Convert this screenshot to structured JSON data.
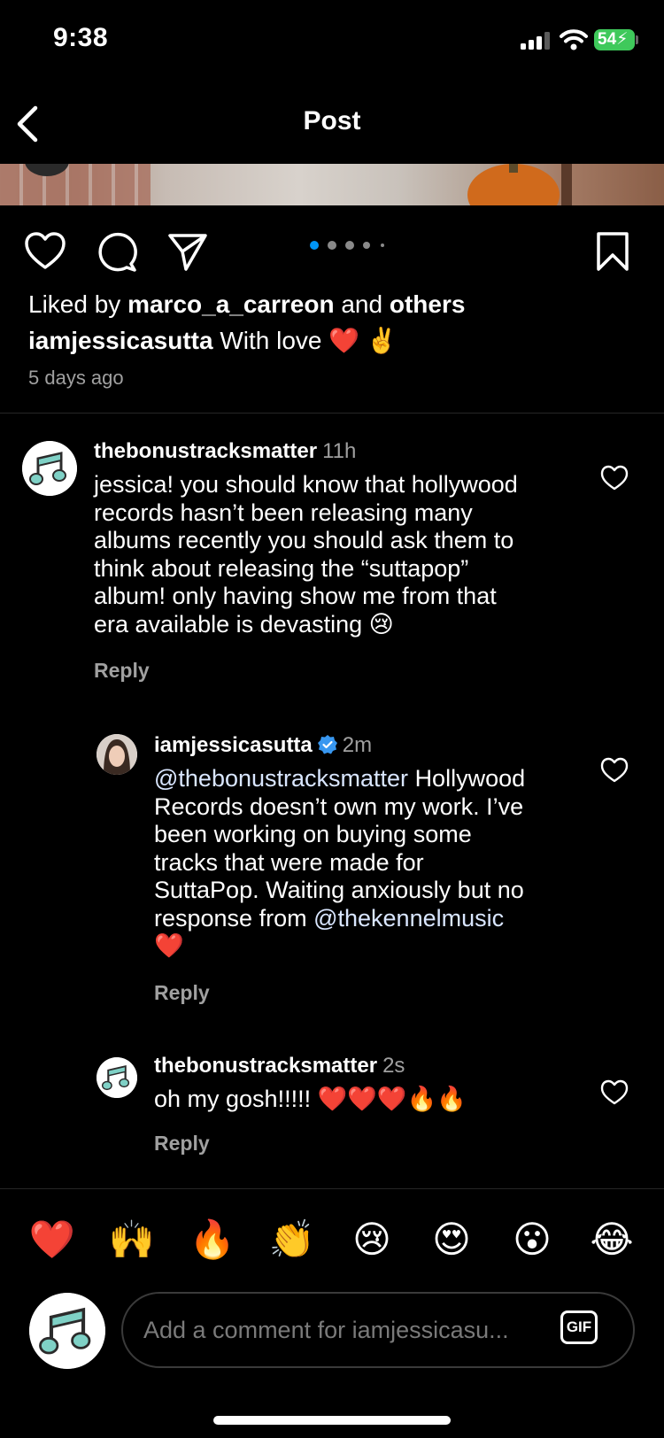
{
  "status_bar": {
    "time": "9:38",
    "battery": "54"
  },
  "nav": {
    "title": "Post"
  },
  "carousel": {
    "dot_count": 5,
    "active_index": 0
  },
  "post": {
    "liked_prefix": "Liked by",
    "liked_user": "marco_a_carreon",
    "liked_mid": "and",
    "liked_others": "others",
    "author": "iamjessicasutta",
    "caption": "With love ❤️ ✌️",
    "time_ago": "5 days ago"
  },
  "comments": [
    {
      "user": "thebonustracksmatter",
      "time": "11h",
      "text_lines": [
        "jessica! you should know that hollywood",
        "records hasn’t been releasing many",
        "albums recently you should ask them to",
        "think about releasing the “suttapop”",
        "album! only having show me from that",
        "era available is devasting 😢"
      ],
      "reply_label": "Reply"
    },
    {
      "user": "iamjessicasutta",
      "time": "2m",
      "verified": true,
      "mention": "@thebonustracksmatter",
      "text_lines": [
        "Hollywood",
        "Records doesn’t own my work. I’ve",
        "been working  on buying some",
        "tracks that were made for",
        "SuttaPop. Waiting anxiously but no",
        "response from"
      ],
      "mention2": "@thekennelmusic",
      "tail": "❤️",
      "reply_label": "Reply"
    },
    {
      "user": "thebonustracksmatter",
      "time": "2s",
      "text": "oh my gosh!!!!! ❤️❤️❤️🔥🔥",
      "reply_label": "Reply"
    }
  ],
  "emoji_bar": [
    "❤️",
    "🙌",
    "🔥",
    "👏",
    "😢",
    "😍",
    "😮",
    "😂"
  ],
  "composer": {
    "placeholder": "Add a comment for iamjessicasu...",
    "gif_label": "GIF"
  },
  "colors": {
    "background": "#000000",
    "accent_blue": "#0095f6",
    "battery_green": "#3fc95b"
  }
}
